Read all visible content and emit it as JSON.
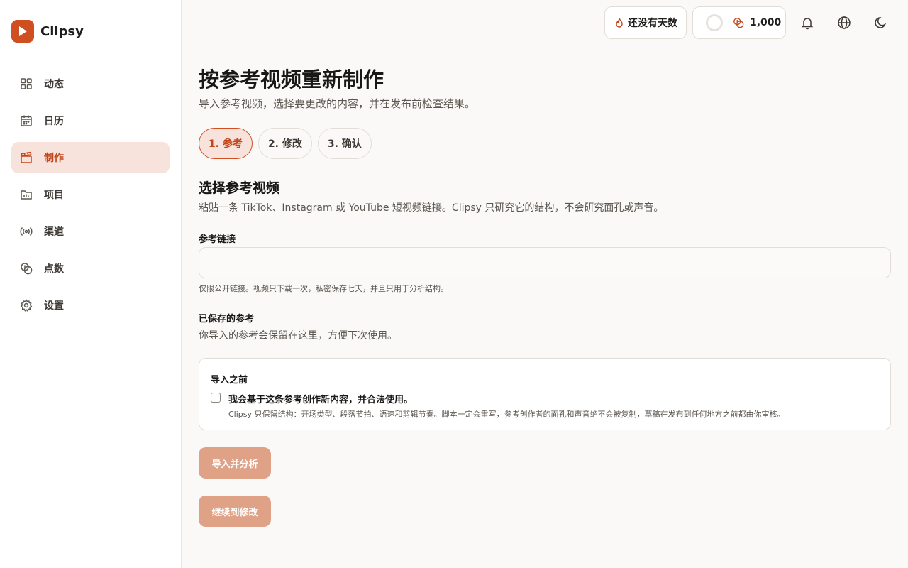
{
  "app": {
    "name": "Clipsy",
    "accent": "#cf4f21"
  },
  "sidebar": {
    "items": [
      {
        "label": "动态",
        "icon": "grid-icon"
      },
      {
        "label": "日历",
        "icon": "calendar-icon"
      },
      {
        "label": "制作",
        "icon": "clapperboard-icon",
        "active": true
      },
      {
        "label": "项目",
        "icon": "folder-chart-icon"
      },
      {
        "label": "渠道",
        "icon": "broadcast-icon"
      },
      {
        "label": "点数",
        "icon": "coins-icon"
      },
      {
        "label": "设置",
        "icon": "gear-icon"
      }
    ]
  },
  "topbar": {
    "streak_label": "还没有天数",
    "credits_value": "1,000"
  },
  "main": {
    "title": "按参考视频重新制作",
    "subtitle": "导入参考视频，选择要更改的内容，并在发布前检查结果。",
    "steps": [
      {
        "label": "1.  参考",
        "active": true
      },
      {
        "label": "2.  修改"
      },
      {
        "label": "3.  确认"
      }
    ],
    "section_title": "选择参考视频",
    "section_subtitle": "粘贴一条 TikTok、Instagram 或 YouTube 短视频链接。Clipsy 只研究它的结构，不会研究面孔或声音。",
    "reference_link": {
      "label": "参考链接",
      "value": "",
      "hint": "仅限公开链接。视频只下载一次，私密保存七天，并且只用于分析结构。"
    },
    "saved": {
      "title": "已保存的参考",
      "subtitle": "你导入的参考会保留在这里，方便下次使用。"
    },
    "notice": {
      "title": "导入之前",
      "checkbox_label": "我会基于这条参考创作新内容，并合法使用。",
      "checked": false,
      "detail": "Clipsy 只保留结构：开场类型、段落节拍、语速和剪辑节奏。脚本一定会重写，参考创作者的面孔和声音绝不会被复制，草稿在发布到任何地方之前都由你审核。"
    },
    "import_button": "导入并分析",
    "continue_button": "继续到修改"
  }
}
